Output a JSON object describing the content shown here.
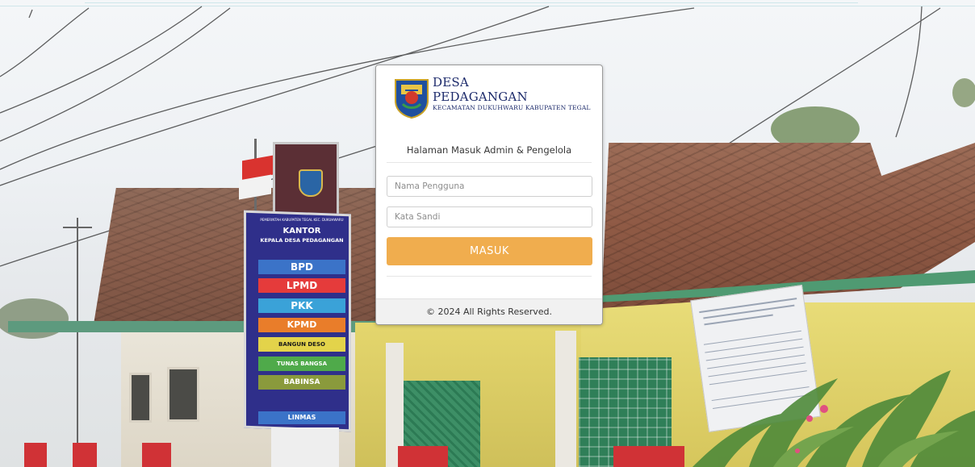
{
  "brand": {
    "name_line1": "DESA",
    "name_line2": "PEDAGANGAN",
    "subtitle": "KECAMATAN DUKUHWARU KABUPATEN TEGAL",
    "logo_icon": "kabupaten-tegal-emblem-icon"
  },
  "login": {
    "heading": "Halaman Masuk Admin & Pengelola",
    "username_placeholder": "Nama Pengguna",
    "username_value": "",
    "password_placeholder": "Kata Sandi",
    "password_value": "",
    "submit_label": "MASUK",
    "footer_text": "© 2024 All Rights Reserved."
  },
  "background_sign": {
    "header_small": "PEMERINTAH KABUPATEN TEGAL KEC. DUKUHWARU",
    "title_line1": "KANTOR",
    "title_line2": "KEPALA DESA PEDAGANGAN",
    "rows": [
      "BPD",
      "LPMD",
      "PKK",
      "KPMD",
      "BANGUN DESO",
      "TUNAS BANGSA",
      "BABINSA",
      "LINMAS"
    ]
  },
  "colors": {
    "accent_button": "#f0ad4e",
    "brand_text": "#1d2b6b",
    "card_background": "#ffffff",
    "footer_background": "#f1f1f1"
  }
}
